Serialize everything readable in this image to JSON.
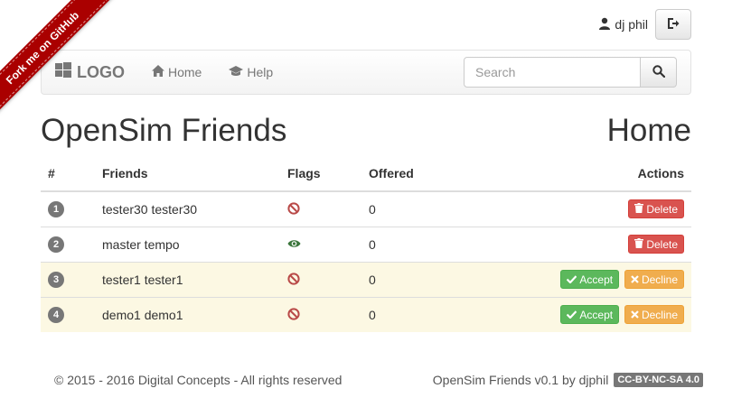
{
  "ribbon": {
    "label": "Fork me on GitHub",
    "color": "#aa0000"
  },
  "user": {
    "name": "dj phil",
    "icon": "user-icon",
    "logout_icon": "sign-out-icon"
  },
  "navbar": {
    "logo_text": "LOGO",
    "logo_icon": "windows-icon",
    "links": [
      {
        "label": "Home",
        "icon": "home-icon"
      },
      {
        "label": "Help",
        "icon": "graduation-cap-icon"
      }
    ],
    "search": {
      "placeholder": "Search",
      "value": "",
      "icon": "search-icon"
    }
  },
  "page": {
    "title": "OpenSim Friends",
    "section": "Home"
  },
  "table": {
    "headers": [
      "#",
      "Friends",
      "Flags",
      "Offered",
      "Actions"
    ],
    "rows": [
      {
        "num": "1",
        "friend": "tester30 tester30",
        "flag": "ban-icon",
        "offered": "0",
        "actions": [
          "Delete"
        ],
        "highlight": false
      },
      {
        "num": "2",
        "friend": "master tempo",
        "flag": "eye-icon",
        "offered": "0",
        "actions": [
          "Delete"
        ],
        "highlight": false
      },
      {
        "num": "3",
        "friend": "tester1 tester1",
        "flag": "ban-icon",
        "offered": "0",
        "actions": [
          "Accept",
          "Decline"
        ],
        "highlight": true
      },
      {
        "num": "4",
        "friend": "demo1 demo1",
        "flag": "ban-icon",
        "offered": "0",
        "actions": [
          "Accept",
          "Decline"
        ],
        "highlight": true
      }
    ]
  },
  "footer": {
    "copyright": "© 2015 - 2016 Digital Concepts - All rights reserved",
    "version": "OpenSim Friends v0.1 by djphil",
    "license": "CC-BY-NC-SA 4.0"
  },
  "colors": {
    "danger": "#d9534f",
    "success": "#5cb85c",
    "warning": "#f0ad4e",
    "row_highlight": "#fcf8e3",
    "ban": "#b94a48",
    "eye": "#3c763d"
  }
}
